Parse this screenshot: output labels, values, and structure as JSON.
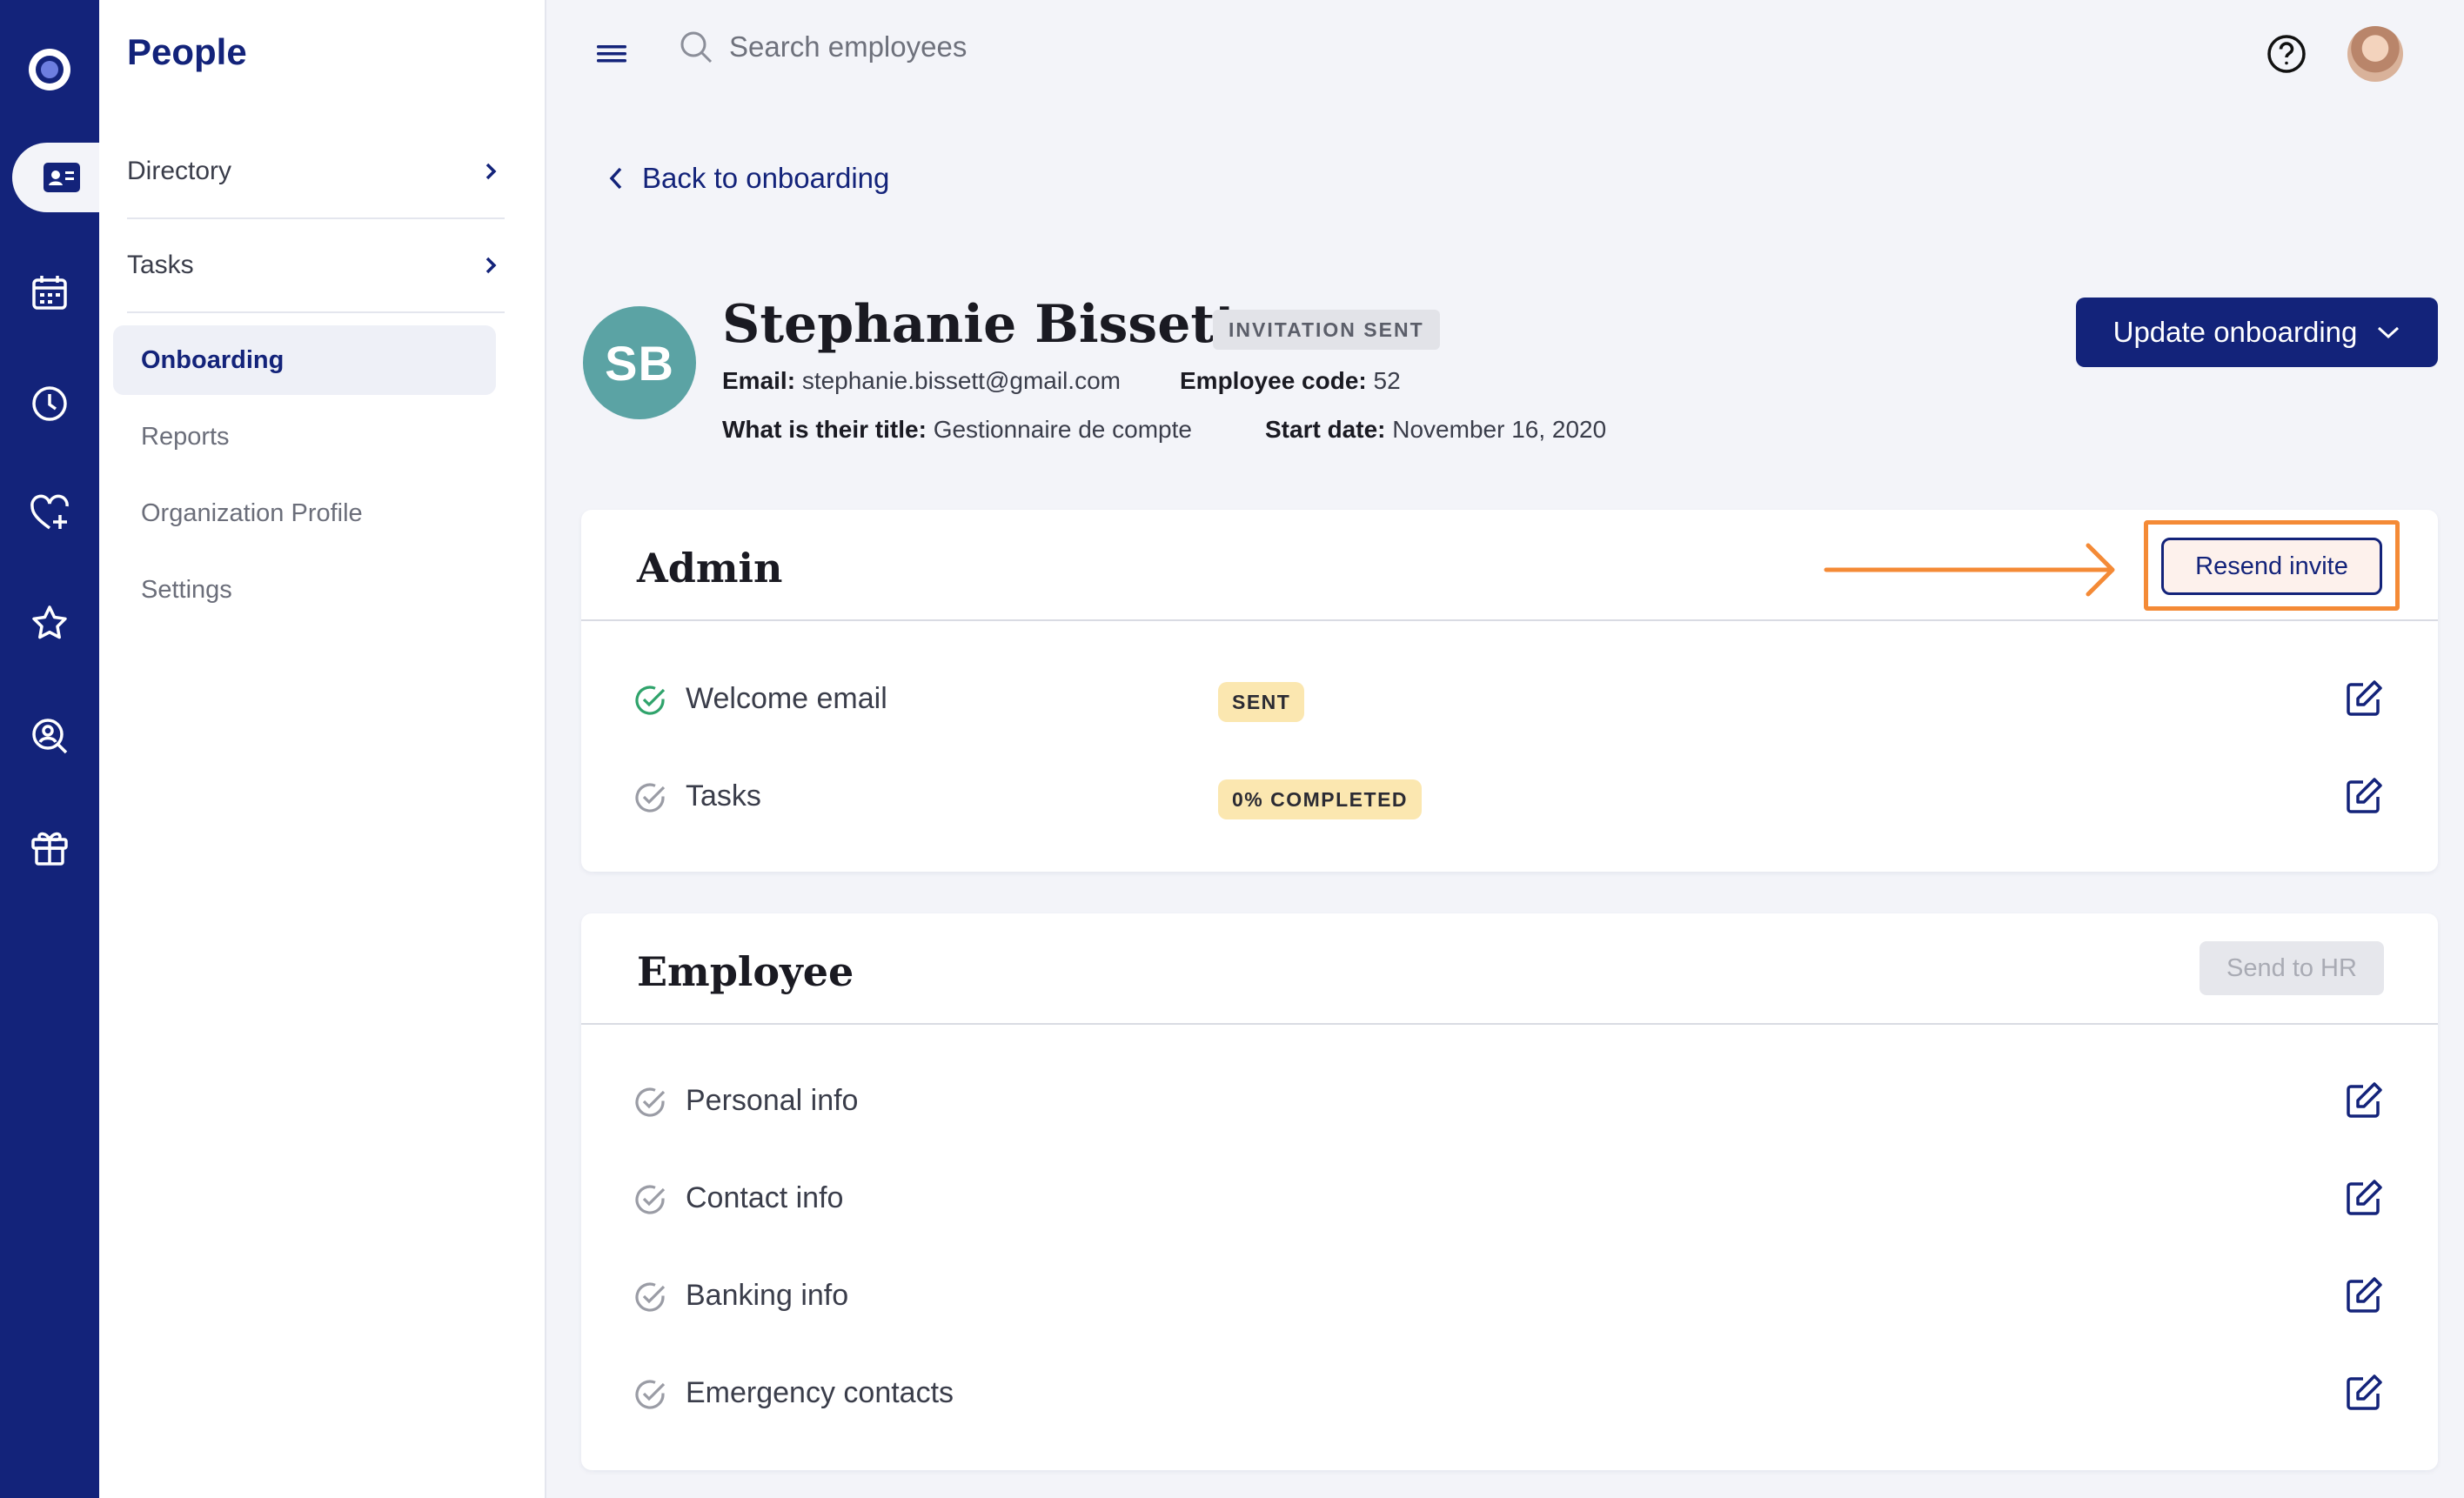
{
  "colors": {
    "navy": "#13237a",
    "teal": "#5ba3a4",
    "orange": "#f48a36",
    "pill_yellow": "#fbe7b0",
    "success_green": "#2fa36b"
  },
  "rail": {
    "icons": [
      "app-logo-icon",
      "people-card-icon",
      "calendar-icon",
      "clock-icon",
      "heart-plus-icon",
      "star-icon",
      "search-person-icon",
      "gift-box-icon"
    ],
    "active": "people-card-icon"
  },
  "subnav": {
    "title": "People",
    "groups": [
      {
        "label": "Directory"
      },
      {
        "label": "Tasks"
      }
    ],
    "items": [
      {
        "label": "Onboarding",
        "active": true
      },
      {
        "label": "Reports"
      },
      {
        "label": "Organization Profile"
      },
      {
        "label": "Settings"
      }
    ]
  },
  "topbar": {
    "search_placeholder": "Search employees"
  },
  "main": {
    "back_label": "Back to onboarding",
    "employee": {
      "initials": "SB",
      "name": "Stephanie Bissett",
      "status": "INVITATION SENT",
      "email_label": "Email:",
      "email": "stephanie.bissett@gmail.com",
      "code_label": "Employee code:",
      "code": "52",
      "title_label": "What is their title:",
      "title": "Gestionnaire de compte",
      "start_label": "Start date:",
      "start": "November 16, 2020"
    },
    "update_button": "Update onboarding",
    "admin": {
      "title": "Admin",
      "resend_label": "Resend invite",
      "rows": [
        {
          "label": "Welcome email",
          "pill": "SENT",
          "done": true
        },
        {
          "label": "Tasks",
          "pill": "0% COMPLETED",
          "done": false
        }
      ]
    },
    "employee_card": {
      "title": "Employee",
      "send_label": "Send to HR",
      "rows": [
        {
          "label": "Personal info"
        },
        {
          "label": "Contact info"
        },
        {
          "label": "Banking info"
        },
        {
          "label": "Emergency contacts"
        }
      ]
    }
  }
}
